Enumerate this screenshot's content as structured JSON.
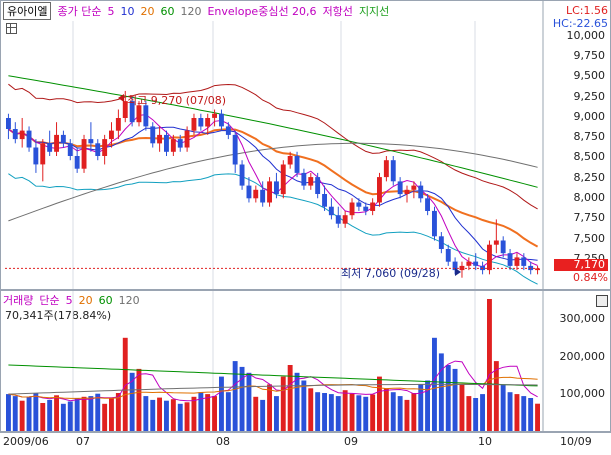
{
  "legend": {
    "stock": "유아이엘",
    "ma_label": "종가 단순",
    "ma_periods": [
      "5",
      "10",
      "20",
      "60",
      "120"
    ],
    "envelope": "Envelope중심선 20,6",
    "resistance": "저항선",
    "support": "지지선"
  },
  "colors": {
    "up": "#e02020",
    "down": "#2a52d9",
    "ma5": "#c000c0",
    "ma10": "#2030d0",
    "ma20": "#e07000",
    "ma60": "#009000",
    "ma120": "#707070",
    "envelope_upper": "#b01818",
    "envelope_center": "#f07020",
    "envelope_lower": "#12a0c0",
    "badge": "#e82020"
  },
  "price_panel": {
    "lc": "LC:1.56",
    "hc": "HC:-22.65",
    "ticks": [
      "10,000",
      "9,750",
      "9,500",
      "9,250",
      "9,000",
      "8,750",
      "8,500",
      "8,250",
      "8,000",
      "7,750",
      "7,500",
      "7,250"
    ],
    "current_price": "7,170",
    "current_pct": "0.84%",
    "high_annotation": "최고 9,270 (07/08)",
    "low_annotation": "최저 7,060 (09/28)"
  },
  "volume_panel": {
    "title": "거래량",
    "ma_label": "단순",
    "ma_periods": [
      "5",
      "20",
      "60",
      "120"
    ],
    "current": "70,341주(178.84%)",
    "ticks": [
      "300,000",
      "200,000",
      "100,000"
    ]
  },
  "date_axis": {
    "labels": [
      "2009/06",
      "07",
      "08",
      "09",
      "10",
      "10/09"
    ]
  },
  "chart_data": {
    "type": "candlestick",
    "y_range": [
      6950,
      10050
    ],
    "volume_range": [
      0,
      340000
    ],
    "candles": [
      [
        8950,
        9000,
        8700,
        8820
      ],
      [
        8820,
        8900,
        8650,
        8700
      ],
      [
        8700,
        8950,
        8600,
        8800
      ],
      [
        8800,
        8850,
        8550,
        8600
      ],
      [
        8600,
        8700,
        8300,
        8400
      ],
      [
        8400,
        8700,
        8200,
        8650
      ],
      [
        8650,
        8800,
        8500,
        8550
      ],
      [
        8550,
        8900,
        8500,
        8750
      ],
      [
        8750,
        8800,
        8600,
        8650
      ],
      [
        8650,
        8700,
        8450,
        8500
      ],
      [
        8500,
        8600,
        8300,
        8350
      ],
      [
        8350,
        8750,
        8300,
        8700
      ],
      [
        8700,
        8900,
        8550,
        8650
      ],
      [
        8650,
        8700,
        8450,
        8500
      ],
      [
        8500,
        8750,
        8400,
        8700
      ],
      [
        8700,
        8900,
        8600,
        8800
      ],
      [
        8800,
        9050,
        8700,
        8950
      ],
      [
        8950,
        9270,
        8900,
        9150
      ],
      [
        9150,
        9200,
        8850,
        8900
      ],
      [
        8900,
        9150,
        8850,
        9100
      ],
      [
        9100,
        9150,
        8800,
        8850
      ],
      [
        8850,
        8900,
        8600,
        8650
      ],
      [
        8650,
        8850,
        8550,
        8750
      ],
      [
        8750,
        8800,
        8500,
        8550
      ],
      [
        8550,
        8750,
        8500,
        8700
      ],
      [
        8700,
        8750,
        8550,
        8600
      ],
      [
        8600,
        8850,
        8550,
        8800
      ],
      [
        8800,
        9000,
        8750,
        8950
      ],
      [
        8950,
        9000,
        8800,
        8850
      ],
      [
        8850,
        9000,
        8750,
        8950
      ],
      [
        8950,
        9050,
        8850,
        9000
      ],
      [
        9000,
        9050,
        8800,
        8850
      ],
      [
        8850,
        8900,
        8700,
        8750
      ],
      [
        8750,
        8800,
        8300,
        8400
      ],
      [
        8400,
        8450,
        8100,
        8150
      ],
      [
        8150,
        8250,
        7950,
        8000
      ],
      [
        8000,
        8150,
        7950,
        8100
      ],
      [
        8100,
        8200,
        7900,
        7950
      ],
      [
        7950,
        8250,
        7900,
        8200
      ],
      [
        8200,
        8300,
        8000,
        8050
      ],
      [
        8050,
        8450,
        8000,
        8400
      ],
      [
        8400,
        8550,
        8350,
        8500
      ],
      [
        8500,
        8550,
        8250,
        8300
      ],
      [
        8300,
        8350,
        8100,
        8150
      ],
      [
        8150,
        8300,
        8100,
        8250
      ],
      [
        8250,
        8300,
        8000,
        8050
      ],
      [
        8050,
        8150,
        7850,
        7900
      ],
      [
        7900,
        8000,
        7750,
        7800
      ],
      [
        7800,
        7900,
        7650,
        7700
      ],
      [
        7700,
        7850,
        7650,
        7800
      ],
      [
        7800,
        8000,
        7750,
        7950
      ],
      [
        7950,
        8000,
        7850,
        7900
      ],
      [
        7900,
        7950,
        7800,
        7850
      ],
      [
        7850,
        8000,
        7800,
        7950
      ],
      [
        7950,
        8300,
        7900,
        8250
      ],
      [
        8250,
        8500,
        8200,
        8450
      ],
      [
        8450,
        8500,
        8150,
        8200
      ],
      [
        8200,
        8250,
        8000,
        8050
      ],
      [
        8050,
        8150,
        7950,
        8100
      ],
      [
        8100,
        8200,
        8000,
        8150
      ],
      [
        8150,
        8200,
        7950,
        8000
      ],
      [
        8000,
        8050,
        7800,
        7850
      ],
      [
        7850,
        7900,
        7500,
        7550
      ],
      [
        7550,
        7600,
        7350,
        7400
      ],
      [
        7400,
        7450,
        7200,
        7250
      ],
      [
        7250,
        7300,
        7100,
        7150
      ],
      [
        7150,
        7250,
        7060,
        7200
      ],
      [
        7200,
        7300,
        7150,
        7250
      ],
      [
        7250,
        7350,
        7150,
        7200
      ],
      [
        7200,
        7250,
        7100,
        7150
      ],
      [
        7150,
        7500,
        7100,
        7450
      ],
      [
        7450,
        7750,
        7350,
        7500
      ],
      [
        7500,
        7550,
        7300,
        7350
      ],
      [
        7350,
        7400,
        7150,
        7200
      ],
      [
        7200,
        7350,
        7150,
        7300
      ],
      [
        7300,
        7350,
        7150,
        7200
      ],
      [
        7200,
        7250,
        7100,
        7150
      ],
      [
        7150,
        7200,
        7100,
        7170
      ]
    ],
    "volumes": [
      95000,
      90000,
      78000,
      88000,
      98000,
      72000,
      80000,
      92000,
      70000,
      76000,
      85000,
      88000,
      90000,
      96000,
      70000,
      84000,
      98000,
      240000,
      150000,
      160000,
      90000,
      80000,
      86000,
      78000,
      82000,
      70000,
      74000,
      88000,
      100000,
      95000,
      90000,
      140000,
      100000,
      180000,
      165000,
      150000,
      88000,
      80000,
      120000,
      90000,
      140000,
      170000,
      150000,
      130000,
      110000,
      100000,
      98000,
      95000,
      90000,
      105000,
      96000,
      92000,
      88000,
      94000,
      140000,
      110000,
      100000,
      90000,
      80000,
      98000,
      120000,
      130000,
      240000,
      200000,
      170000,
      160000,
      120000,
      90000,
      85000,
      95000,
      340000,
      180000,
      120000,
      100000,
      95000,
      90000,
      85000,
      70341
    ]
  }
}
